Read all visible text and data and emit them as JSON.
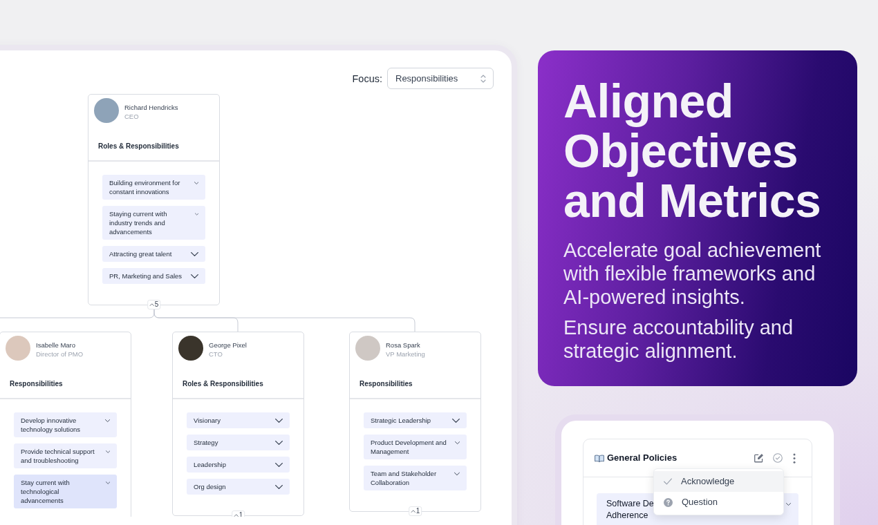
{
  "org_chart": {
    "focus": {
      "label": "Focus:",
      "value": "Responsibilities"
    },
    "root": {
      "name": "Richard Hendricks",
      "title": "CEO",
      "section": "Roles & Responsibilities",
      "items": [
        {
          "text": "Building environment for constant innovations",
          "selected": false
        },
        {
          "text": "Staying current with industry trends and advancements",
          "selected": false
        },
        {
          "text": "Attracting great talent",
          "selected": false
        },
        {
          "text": "PR, Marketing and Sales",
          "selected": false
        }
      ],
      "count": "5",
      "children": [
        {
          "name": "Isabelle Maro",
          "title": "Director of PMO",
          "section": "Responsibilities",
          "items": [
            {
              "text": "Develop innovative technology solutions",
              "selected": false
            },
            {
              "text": "Provide technical support and troubleshooting",
              "selected": false
            },
            {
              "text": "Stay current with technological advancements",
              "selected": true
            }
          ]
        },
        {
          "name": "George Pixel",
          "title": "CTO",
          "section": "Roles & Responsibilities",
          "items": [
            {
              "text": "Visionary",
              "selected": false
            },
            {
              "text": "Strategy",
              "selected": false
            },
            {
              "text": "Leadership",
              "selected": false
            },
            {
              "text": "Org design",
              "selected": false
            }
          ],
          "count": "1"
        },
        {
          "name": "Rosa Spark",
          "title": "VP Marketing",
          "section": "Responsibilities",
          "items": [
            {
              "text": "Strategic Leadership",
              "selected": false
            },
            {
              "text": "Product Development and Management",
              "selected": false
            },
            {
              "text": "Team and Stakeholder Collaboration",
              "selected": false
            }
          ],
          "count": "1"
        }
      ]
    }
  },
  "promo": {
    "heading": "Aligned Objectives and Metrics",
    "paragraphs": [
      "Accelerate goal achievement with flexible frameworks and AI-powered insights.",
      "Ensure accountability and strategic alignment."
    ]
  },
  "policies": {
    "title": "General Policies",
    "items": [
      {
        "lines": [
          "Software De",
          "Adherence"
        ]
      }
    ],
    "menu": [
      {
        "label": "Acknowledge",
        "selected": true
      },
      {
        "label": "Question",
        "selected": false
      }
    ]
  }
}
